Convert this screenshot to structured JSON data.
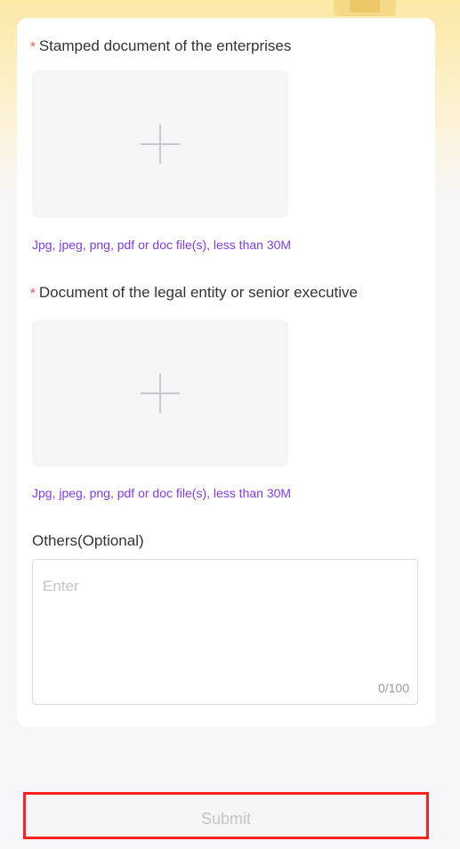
{
  "form": {
    "stamped_document": {
      "required_mark": "*",
      "label": "Stamped document of the enterprises",
      "upload_icon": "plus-icon",
      "hint": "Jpg, jpeg, png, pdf or doc file(s), less than 30M"
    },
    "legal_document": {
      "required_mark": "*",
      "label": "Document of the legal entity or senior executive",
      "upload_icon": "plus-icon",
      "hint": "Jpg, jpeg, png, pdf or doc file(s), less than 30M"
    },
    "others": {
      "label": "Others(Optional)",
      "placeholder": "Enter",
      "value": "",
      "counter": "0/100"
    }
  },
  "submit": {
    "label": "Submit"
  },
  "colors": {
    "required": "#ff4d4f",
    "hint": "#7d3cf0",
    "highlight": "#ff2020"
  }
}
